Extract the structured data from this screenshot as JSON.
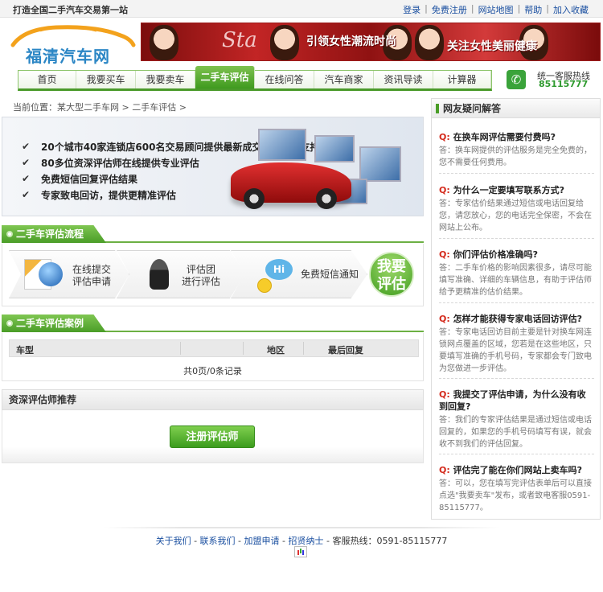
{
  "topbar": {
    "slogan": "打造全国二手汽车交易第一站",
    "links": [
      "登录",
      "免费注册",
      "网站地图",
      "帮助",
      "加入收藏"
    ]
  },
  "logo": {
    "text": "福清汽车网"
  },
  "banner": {
    "script": "Sta",
    "text1": "引领女性潮流时尚",
    "text2": "关注女性美丽健康"
  },
  "nav": {
    "items": [
      "首页",
      "我要买车",
      "我要卖车",
      "二手车评估",
      "在线问答",
      "汽车商家",
      "资讯导读",
      "计算器"
    ],
    "active_index": 3
  },
  "hotline": {
    "title": "统一客服热线",
    "number": "85115777"
  },
  "breadcrumb": "当前位置：某大型二手车网 > 二手车评估 >",
  "promo": {
    "lines": [
      "20个城市40家连锁店600名交易顾问提供最新成交价格数据支持",
      "80多位资深评估师在线提供专业评估",
      "免费短信回复评估结果",
      "专家致电回访，提供更精准评估"
    ]
  },
  "process": {
    "title": "二手车评估流程",
    "steps": [
      {
        "line1": "在线提交",
        "line2": "评估申请"
      },
      {
        "line1": "评估团",
        "line2": "进行评估"
      },
      {
        "line1": "免费短信通知",
        "line2": ""
      }
    ],
    "bubble_text": "Hi",
    "button_line1": "我要",
    "button_line2": "评估"
  },
  "cases": {
    "title": "二手车评估案例",
    "columns": [
      "车型",
      "地区",
      "最后回复"
    ],
    "pager": "共0页/0条记录"
  },
  "assessor": {
    "title": "资深评估师推荐",
    "register_label": "注册评估师"
  },
  "faq": {
    "title": "网友疑问解答",
    "q_marker": "Q:",
    "items": [
      {
        "q": "在换车网评估需要付费吗?",
        "a": "答：换车网提供的评估服务是完全免费的，您不需要任何费用。"
      },
      {
        "q": "为什么一定要填写联系方式?",
        "a": "答：专家估价结果通过短信或电话回复给您，请您放心，您的电话完全保密，不会在网站上公布。"
      },
      {
        "q": "你们评估价格准确吗?",
        "a": "答：二手车价格的影响因素很多，请尽可能填写准确、详细的车辆信息，有助于评估师给予更精准的估价结果。"
      },
      {
        "q": "怎样才能获得专家电话回访评估?",
        "a": "答：专家电话回访目前主要是针对换车网连锁网点覆盖的区域，您若是在这些地区，只要填写准确的手机号码，专家都会专门致电为您做进一步评估。"
      },
      {
        "q": "我提交了评估申请，为什么没有收到回复?",
        "a": "答：我们的专家评估结果是通过短信或电话回复的，如果您的手机号码填写有误，就会收不到我们的评估回复。"
      },
      {
        "q": "评估完了能在你们网站上卖车吗?",
        "a": "答：可以，您在填写完评估表单后可以直接点选\"我要卖车\"发布，或者致电客服0591-85115777。"
      }
    ]
  },
  "footer": {
    "links": [
      "关于我们",
      "联系我们",
      "加盟申请",
      "招贤纳士"
    ],
    "hotline_label": "客服热线：",
    "hotline_number": "0591-85115777"
  }
}
